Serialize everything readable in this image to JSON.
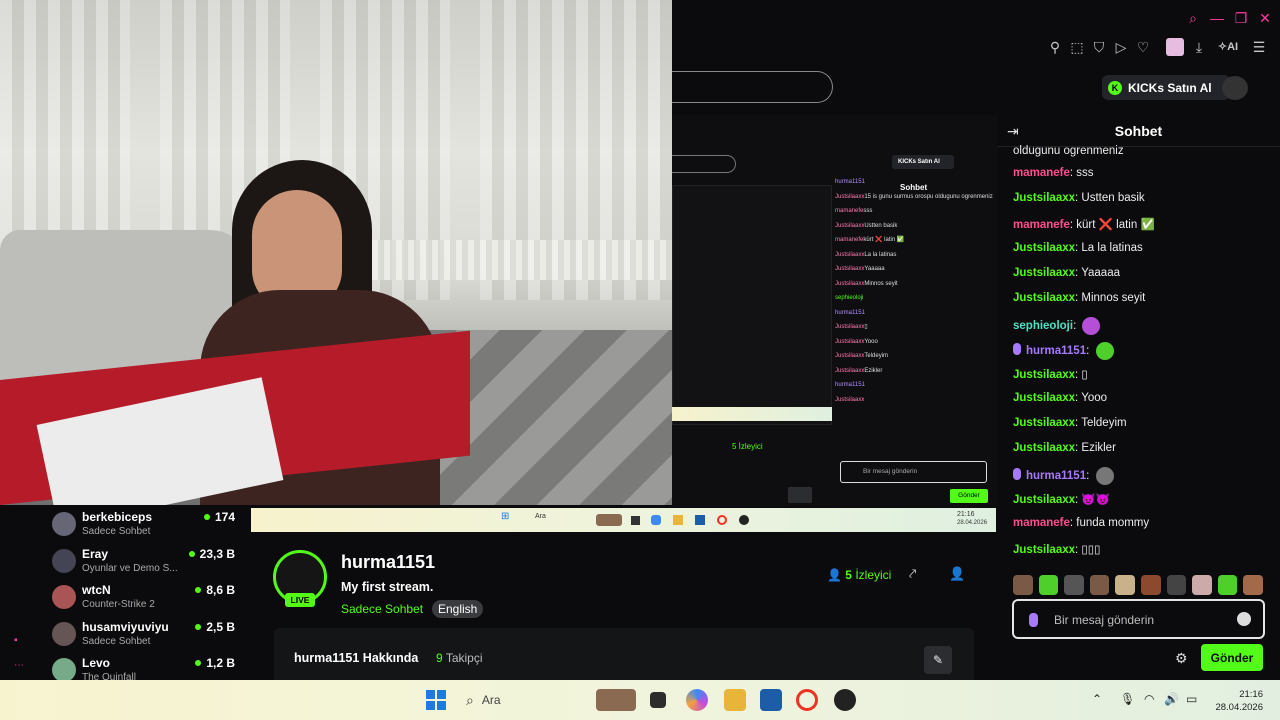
{
  "browser": {
    "kicks_button_label": "KICKs Satın Al",
    "ai_label": "AI"
  },
  "inner_preview": {
    "chat_title": "Sohbet",
    "kicks_label": "KICKs Satın Al",
    "messages": [
      {
        "user": "hurma1151",
        "text": "",
        "color": "purple"
      },
      {
        "user": "Justsilaaxx",
        "text": "15 is gunu surmus orospu oldugunu ogrenmeniz",
        "color": "pink"
      },
      {
        "user": "mamanefe",
        "text": "sss",
        "color": "pink"
      },
      {
        "user": "Justsilaaxx",
        "text": "Ustten basik",
        "color": "pink"
      },
      {
        "user": "mamanefe",
        "text": "kürt ❌ latin ✅",
        "color": "pink"
      },
      {
        "user": "Justsilaaxx",
        "text": "La la latinas",
        "color": "pink"
      },
      {
        "user": "Justsilaaxx",
        "text": "Yaaaaa",
        "color": "pink"
      },
      {
        "user": "Justsilaaxx",
        "text": "Minnos seyit",
        "color": "pink"
      },
      {
        "user": "sephieoloji",
        "text": "",
        "color": "green"
      },
      {
        "user": "hurma1151",
        "text": "",
        "color": "purple"
      },
      {
        "user": "Justsilaaxx",
        "text": "▯",
        "color": "pink"
      },
      {
        "user": "Justsilaaxx",
        "text": "Yooo",
        "color": "pink"
      },
      {
        "user": "Justsilaaxx",
        "text": "Teldeyim",
        "color": "pink"
      },
      {
        "user": "Justsilaaxx",
        "text": "Ezikler",
        "color": "pink"
      },
      {
        "user": "hurma1151",
        "text": "",
        "color": "purple"
      },
      {
        "user": "Justsilaaxx",
        "text": "",
        "color": "pink"
      }
    ],
    "input_placeholder": "Bir mesaj gönderin",
    "send_label": "Gönder",
    "viewers_label": "5 İzleyici",
    "taskbar_search": "Ara",
    "clock_time": "21:16",
    "clock_date": "28.04.2026"
  },
  "chat": {
    "title": "Sohbet",
    "partial_top": "oldugunu ogrenmeniz",
    "messages": [
      {
        "user": "mamanefe",
        "text": "sss",
        "style": "pink",
        "mic": false,
        "emote": false
      },
      {
        "user": "Justsilaaxx",
        "text": "Ustten basik",
        "style": "green",
        "mic": false,
        "emote": false
      },
      {
        "user": "mamanefe",
        "text": "kürt ❌ latin ✅",
        "style": "pink",
        "mic": false,
        "emote": false
      },
      {
        "user": "Justsilaaxx",
        "text": "La la latinas",
        "style": "green",
        "mic": false,
        "emote": false
      },
      {
        "user": "Justsilaaxx",
        "text": "Yaaaaa",
        "style": "green",
        "mic": false,
        "emote": false
      },
      {
        "user": "Justsilaaxx",
        "text": "Minnos seyit",
        "style": "green",
        "mic": false,
        "emote": false
      },
      {
        "user": "sephieoloji",
        "text": "",
        "style": "teal",
        "mic": false,
        "emote": true
      },
      {
        "user": "hurma1151",
        "text": "",
        "style": "purple",
        "mic": true,
        "emote": true
      },
      {
        "user": "Justsilaaxx",
        "text": "▯",
        "style": "green",
        "mic": false,
        "emote": false
      },
      {
        "user": "Justsilaaxx",
        "text": "Yooo",
        "style": "green",
        "mic": false,
        "emote": false
      },
      {
        "user": "Justsilaaxx",
        "text": "Teldeyim",
        "style": "green",
        "mic": false,
        "emote": false
      },
      {
        "user": "Justsilaaxx",
        "text": "Ezikler",
        "style": "green",
        "mic": false,
        "emote": false
      },
      {
        "user": "hurma1151",
        "text": "",
        "style": "purple",
        "mic": true,
        "emote": true
      },
      {
        "user": "Justsilaaxx",
        "text": "😈😈",
        "style": "green",
        "mic": false,
        "emote": false
      },
      {
        "user": "mamanefe",
        "text": "funda mommy",
        "style": "pink",
        "mic": false,
        "emote": false
      },
      {
        "user": "Justsilaaxx",
        "text": "▯▯▯",
        "style": "green",
        "mic": false,
        "emote": false
      }
    ],
    "input_placeholder": "Bir mesaj gönderin",
    "send_label": "Gönder"
  },
  "channels": [
    {
      "name": "berkebiceps",
      "category": "Sadece Sohbet",
      "viewers": "174"
    },
    {
      "name": "Eray",
      "category": "Oyunlar ve Demo S...",
      "viewers": "23,3 B"
    },
    {
      "name": "wtcN",
      "category": "Counter-Strike 2",
      "viewers": "8,6 B"
    },
    {
      "name": "husamviyuviyu",
      "category": "Sadece Sohbet",
      "viewers": "2,5 B"
    },
    {
      "name": "Levo",
      "category": "The Quinfall",
      "viewers": "1,2 B"
    }
  ],
  "stream": {
    "live_label": "LIVE",
    "streamer": "hurma1151",
    "title": "My first stream.",
    "category": "Sadece Sohbet",
    "language": "English",
    "viewers_count": "5",
    "viewers_label": "İzleyici",
    "about_title": "hurma1151 Hakkında",
    "followers_count": "9",
    "followers_label": "Takipçi"
  },
  "taskbar": {
    "search_placeholder": "Ara",
    "time": "21:16",
    "date": "28.04.2026"
  },
  "colors": {
    "brand_green": "#53fc18",
    "pink_user": "#ff4d8f",
    "purple_user": "#a779ff",
    "background": "#0b0b0d"
  }
}
